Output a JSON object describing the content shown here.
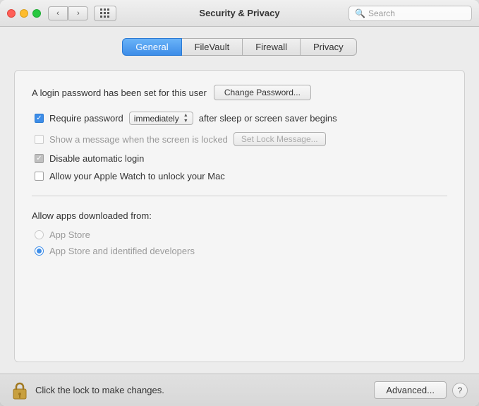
{
  "window": {
    "title": "Security & Privacy"
  },
  "titlebar": {
    "back_label": "‹",
    "forward_label": "›"
  },
  "search": {
    "placeholder": "Search"
  },
  "tabs": [
    {
      "id": "general",
      "label": "General",
      "active": true
    },
    {
      "id": "filevault",
      "label": "FileVault",
      "active": false
    },
    {
      "id": "firewall",
      "label": "Firewall",
      "active": false
    },
    {
      "id": "privacy",
      "label": "Privacy",
      "active": false
    }
  ],
  "general": {
    "login_password_text": "A login password has been set for this user",
    "change_password_label": "Change Password...",
    "require_password_label": "Require password",
    "immediately_value": "immediately",
    "after_sleep_label": "after sleep or screen saver begins",
    "show_message_label": "Show a message when the screen is locked",
    "set_lock_message_label": "Set Lock Message...",
    "disable_login_label": "Disable automatic login",
    "allow_watch_label": "Allow your Apple Watch to unlock your Mac",
    "allow_apps_label": "Allow apps downloaded from:",
    "app_store_label": "App Store",
    "app_store_developers_label": "App Store and identified developers"
  },
  "bottom": {
    "lock_text": "Click the lock to make changes.",
    "advanced_label": "Advanced...",
    "help_label": "?"
  },
  "colors": {
    "active_tab": "#3d8de8",
    "checkbox_checked": "#3d8de8"
  }
}
